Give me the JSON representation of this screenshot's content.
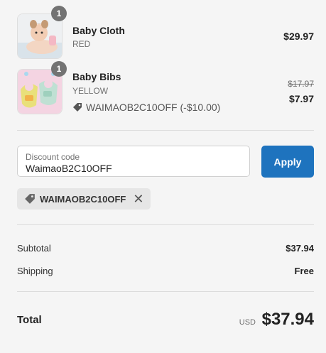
{
  "items": [
    {
      "quantity": "1",
      "name": "Baby Cloth",
      "variant": "RED",
      "price": "$29.97",
      "image_icon": "baby-photo-icon"
    },
    {
      "quantity": "1",
      "name": "Baby Bibs",
      "variant": "YELLOW",
      "discount_text": "WAIMAOB2C10OFF (-$10.00)",
      "compare_price": "$17.97",
      "price": "$7.97",
      "image_icon": "bibs-photo-icon"
    }
  ],
  "discount": {
    "label": "Discount code",
    "value": "WaimaoB2C10OFF",
    "apply_label": "Apply",
    "applied_code": "WAIMAOB2C10OFF"
  },
  "summary": {
    "subtotal_label": "Subtotal",
    "subtotal_value": "$37.94",
    "shipping_label": "Shipping",
    "shipping_value": "Free",
    "total_label": "Total",
    "currency": "USD",
    "total_value": "$37.94"
  },
  "colors": {
    "accent": "#1e73be",
    "background": "#f5f5f5",
    "badge": "#737373"
  }
}
